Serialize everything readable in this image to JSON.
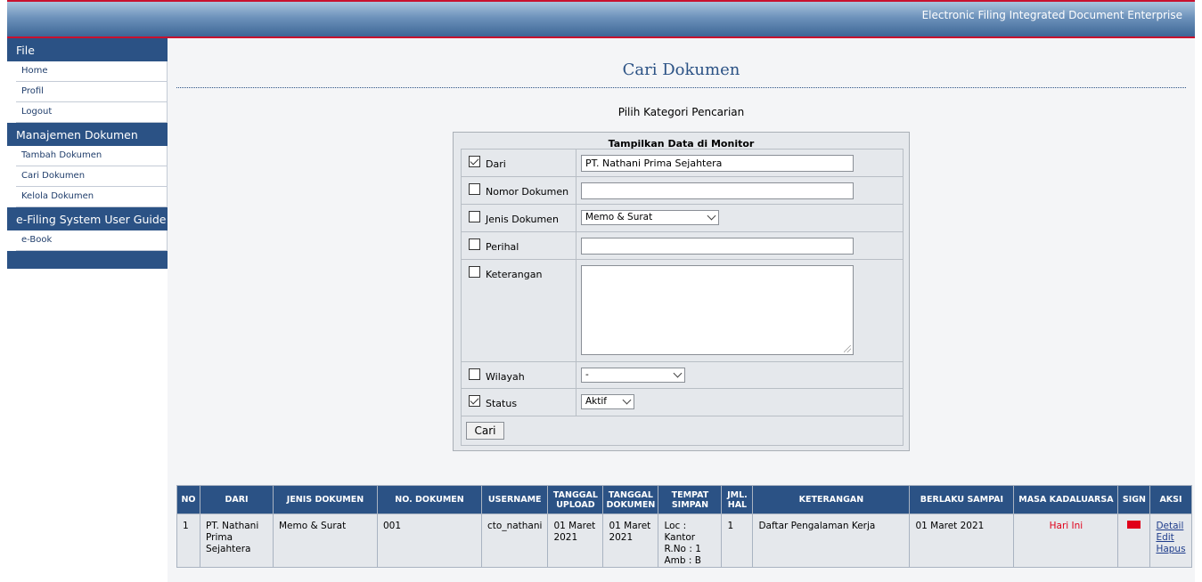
{
  "header": {
    "app_title": "Electronic Filing Integrated Document Enterprise"
  },
  "sidebar": {
    "sections": [
      {
        "title": "File",
        "items": [
          "Home",
          "Profil",
          "Logout"
        ]
      },
      {
        "title": "Manajemen Dokumen",
        "items": [
          "Tambah Dokumen",
          "Cari Dokumen",
          "Kelola Dokumen"
        ]
      },
      {
        "title": "e-Filing System User Guide",
        "items": [
          "e-Book"
        ]
      }
    ]
  },
  "main": {
    "title": "Cari Dokumen",
    "subtitle": "Pilih Kategori Pencarian",
    "form": {
      "heading": "Tampilkan Data di Monitor",
      "dari": {
        "label": "Dari",
        "checked": true,
        "value": "PT. Nathani Prima Sejahtera"
      },
      "nomor_dokumen": {
        "label": "Nomor Dokumen",
        "checked": false,
        "value": ""
      },
      "jenis_dokumen": {
        "label": "Jenis Dokumen",
        "checked": false,
        "selected": "Memo & Surat"
      },
      "perihal": {
        "label": "Perihal",
        "checked": false,
        "value": ""
      },
      "keterangan": {
        "label": "Keterangan",
        "checked": false,
        "value": ""
      },
      "wilayah": {
        "label": "Wilayah",
        "checked": false,
        "selected": "-"
      },
      "status": {
        "label": "Status",
        "checked": true,
        "selected": "Aktif"
      },
      "submit_label": "Cari"
    },
    "table": {
      "headers": {
        "no": "NO",
        "dari": "DARI",
        "jenis": "JENIS DOKUMEN",
        "nomor": "NO. DOKUMEN",
        "username": "USERNAME",
        "upload_1": "TANGGAL",
        "upload_2": "UPLOAD",
        "tgldok_1": "TANGGAL",
        "tgldok_2": "DOKUMEN",
        "simpan_1": "TEMPAT",
        "simpan_2": "SIMPAN",
        "jml_1": "JML.",
        "jml_2": "HAL",
        "keterangan": "KETERANGAN",
        "berlaku": "BERLAKU SAMPAI",
        "masa": "MASA KADALUARSA",
        "sign": "SIGN",
        "aksi": "AKSI"
      },
      "rows": [
        {
          "no": "1",
          "dari_1": "PT. Nathani",
          "dari_2": "Prima",
          "dari_3": "Sejahtera",
          "jenis": "Memo & Surat",
          "nomor": "001",
          "username": "cto_nathani",
          "upload_1": "01 Maret",
          "upload_2": "2021",
          "tgldok_1": "01 Maret",
          "tgldok_2": "2021",
          "simpan_1": "Loc : Kantor",
          "simpan_2": "R.No : 1",
          "simpan_3": "Amb : B",
          "jml": "1",
          "keterangan": "Daftar Pengalaman Kerja",
          "berlaku": "01 Maret 2021",
          "masa": "Hari Ini",
          "sign_color": "#e0001a",
          "aksi_detail": "Detail",
          "aksi_edit": "Edit",
          "aksi_hapus": "Hapus"
        }
      ]
    }
  }
}
